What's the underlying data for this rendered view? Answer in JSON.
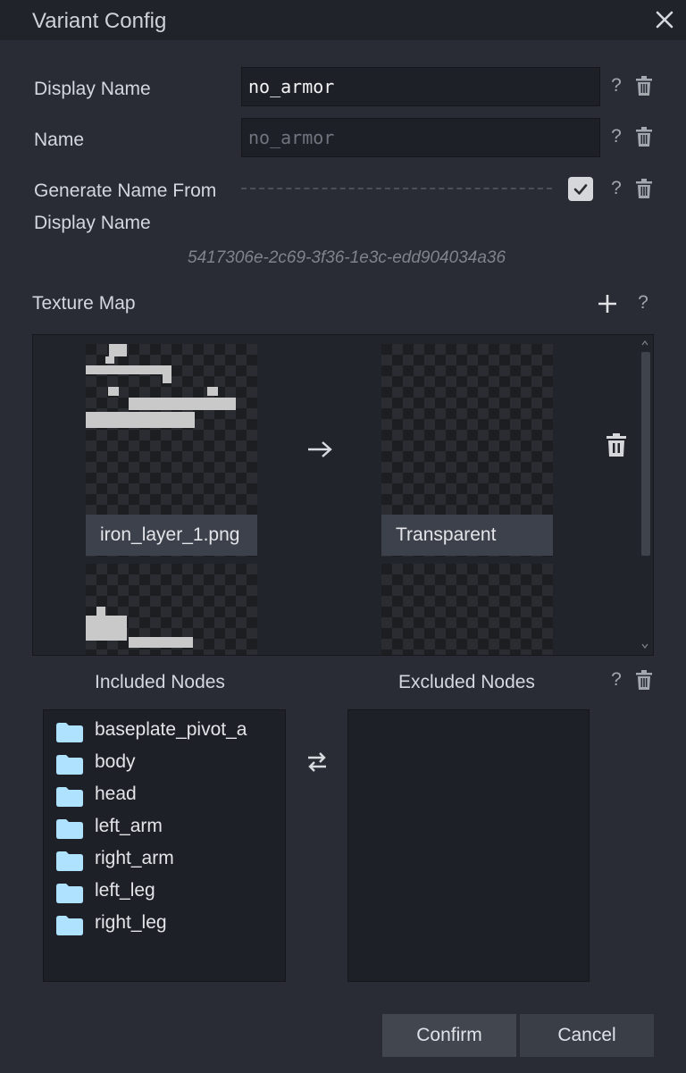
{
  "window": {
    "title": "Variant Config"
  },
  "form": {
    "display_name": {
      "label": "Display Name",
      "value": "no_armor"
    },
    "name": {
      "label": "Name",
      "placeholder": "no_armor"
    },
    "generate_name": {
      "label_line1": "Generate Name From",
      "label_line2": "Display Name",
      "checked": true
    },
    "uuid": "5417306e-2c69-3f36-1e3c-edd904034a36",
    "help_glyph": "?"
  },
  "texture_map": {
    "label": "Texture Map",
    "entries": [
      {
        "source": "iron_layer_1.png",
        "target": "Transparent"
      }
    ]
  },
  "nodes": {
    "included_label": "Included Nodes",
    "excluded_label": "Excluded Nodes",
    "included": [
      "baseplate_pivot_a",
      "body",
      "head",
      "left_arm",
      "right_arm",
      "left_leg",
      "right_leg"
    ],
    "excluded": []
  },
  "buttons": {
    "confirm": "Confirm",
    "cancel": "Cancel"
  },
  "colors": {
    "folder": "#aee2ff",
    "background": "#292c34",
    "titlebar": "#20232a"
  }
}
